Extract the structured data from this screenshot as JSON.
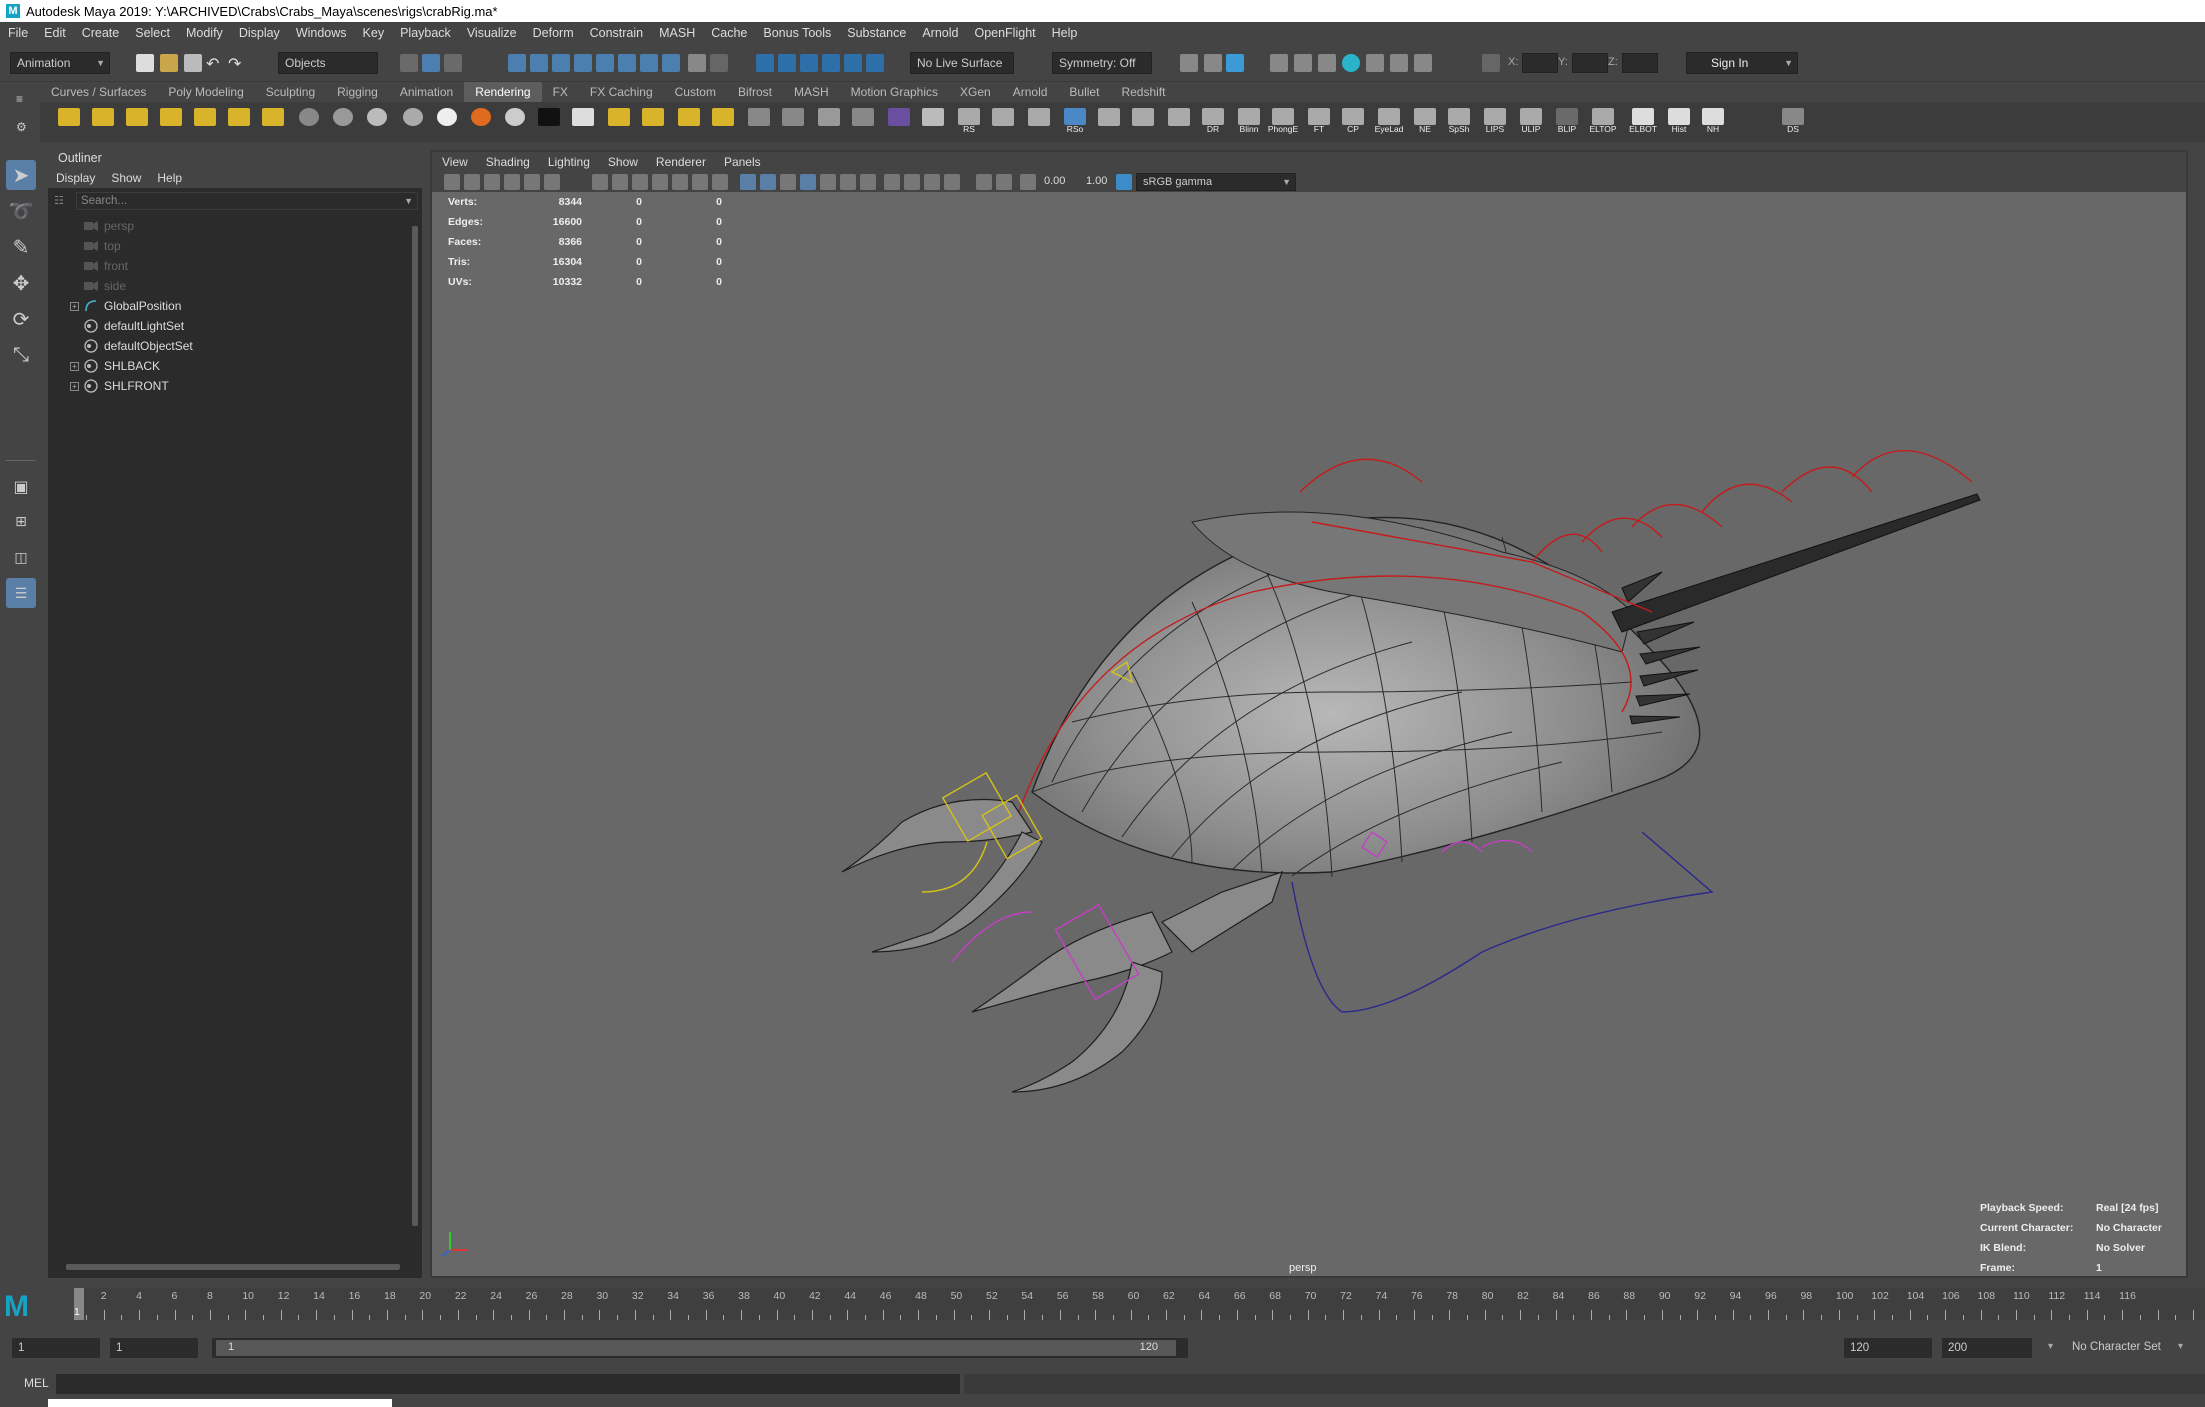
{
  "window": {
    "title": "Autodesk Maya 2019: Y:\\ARCHIVED\\Crabs\\Crabs_Maya\\scenes\\rigs\\crabRig.ma*"
  },
  "menubar": [
    "File",
    "Edit",
    "Create",
    "Select",
    "Modify",
    "Display",
    "Windows",
    "Key",
    "Playback",
    "Visualize",
    "Deform",
    "Constrain",
    "MASH",
    "Cache",
    "Bonus Tools",
    "Substance",
    "Arnold",
    "OpenFlight",
    "Help"
  ],
  "statusline": {
    "menuset": "Animation",
    "selection_mode": "Objects",
    "live_surface": "No Live Surface",
    "symmetry": "Symmetry: Off",
    "x_label": "X:",
    "y_label": "Y:",
    "z_label": "Z:",
    "sign_in": "Sign In"
  },
  "shelf_tabs": [
    "Curves / Surfaces",
    "Poly Modeling",
    "Sculpting",
    "Rigging",
    "Animation",
    "Rendering",
    "FX",
    "FX Caching",
    "Custom",
    "Bifrost",
    "MASH",
    "Motion Graphics",
    "XGen",
    "Arnold",
    "Bullet",
    "Redshift"
  ],
  "shelf_active": "Rendering",
  "shelf_labels": [
    "RS",
    "RSo",
    "DR",
    "Blinn",
    "PhongE",
    "FT",
    "CP",
    "EyeLad",
    "NE",
    "SpSh",
    "LIPS",
    "ULIP",
    "BLIP",
    "ELTOP",
    "ELBOT",
    "Hist",
    "NH",
    "DS",
    "RSo"
  ],
  "outliner": {
    "title": "Outliner",
    "menu": [
      "Display",
      "Show",
      "Help"
    ],
    "search_placeholder": "Search...",
    "items": [
      {
        "label": "persp",
        "dim": true,
        "icon": "camera-icon"
      },
      {
        "label": "top",
        "dim": true,
        "icon": "camera-icon"
      },
      {
        "label": "front",
        "dim": true,
        "icon": "camera-icon"
      },
      {
        "label": "side",
        "dim": true,
        "icon": "camera-icon"
      },
      {
        "label": "GlobalPosition",
        "dim": false,
        "icon": "curve-icon",
        "expandable": true
      },
      {
        "label": "defaultLightSet",
        "dim": false,
        "icon": "set-icon"
      },
      {
        "label": "defaultObjectSet",
        "dim": false,
        "icon": "set-icon"
      },
      {
        "label": "SHLBACK",
        "dim": false,
        "icon": "set-icon",
        "expandable": true
      },
      {
        "label": "SHLFRONT",
        "dim": false,
        "icon": "set-icon",
        "expandable": true
      }
    ]
  },
  "viewport": {
    "menu": [
      "View",
      "Shading",
      "Lighting",
      "Show",
      "Renderer",
      "Panels"
    ],
    "exposure": "0.00",
    "gamma": "1.00",
    "color_space": "sRGB gamma",
    "camera_label": "persp",
    "stats": [
      {
        "label": "Verts:",
        "v1": "8344",
        "v2": "0",
        "v3": "0"
      },
      {
        "label": "Edges:",
        "v1": "16600",
        "v2": "0",
        "v3": "0"
      },
      {
        "label": "Faces:",
        "v1": "8366",
        "v2": "0",
        "v3": "0"
      },
      {
        "label": "Tris:",
        "v1": "16304",
        "v2": "0",
        "v3": "0"
      },
      {
        "label": "UVs:",
        "v1": "10332",
        "v2": "0",
        "v3": "0"
      }
    ],
    "hud": [
      {
        "label": "Playback Speed:",
        "value": "Real [24 fps]"
      },
      {
        "label": "Current Character:",
        "value": "No Character"
      },
      {
        "label": "IK Blend:",
        "value": "No Solver"
      },
      {
        "label": "Frame:",
        "value": "1"
      }
    ]
  },
  "timeline": {
    "ticks": [
      "2",
      "4",
      "6",
      "8",
      "10",
      "12",
      "14",
      "16",
      "18",
      "20",
      "22",
      "24",
      "26",
      "28",
      "30",
      "32",
      "34",
      "36",
      "38",
      "40",
      "42",
      "44",
      "46",
      "48",
      "50",
      "52",
      "54",
      "56",
      "58",
      "60",
      "62",
      "64",
      "66",
      "68",
      "70",
      "72",
      "74",
      "76",
      "78",
      "80",
      "82",
      "84",
      "86",
      "88",
      "90",
      "92",
      "94",
      "96",
      "98",
      "100",
      "102",
      "104",
      "106",
      "108",
      "110",
      "112",
      "114",
      "116"
    ],
    "current": "1"
  },
  "range": {
    "start": "1",
    "playback_start": "1",
    "slider_start": "1",
    "slider_end": "120",
    "playback_end": "120",
    "end": "200",
    "character_set": "No Character Set"
  },
  "cmdline": {
    "label": "MEL"
  }
}
